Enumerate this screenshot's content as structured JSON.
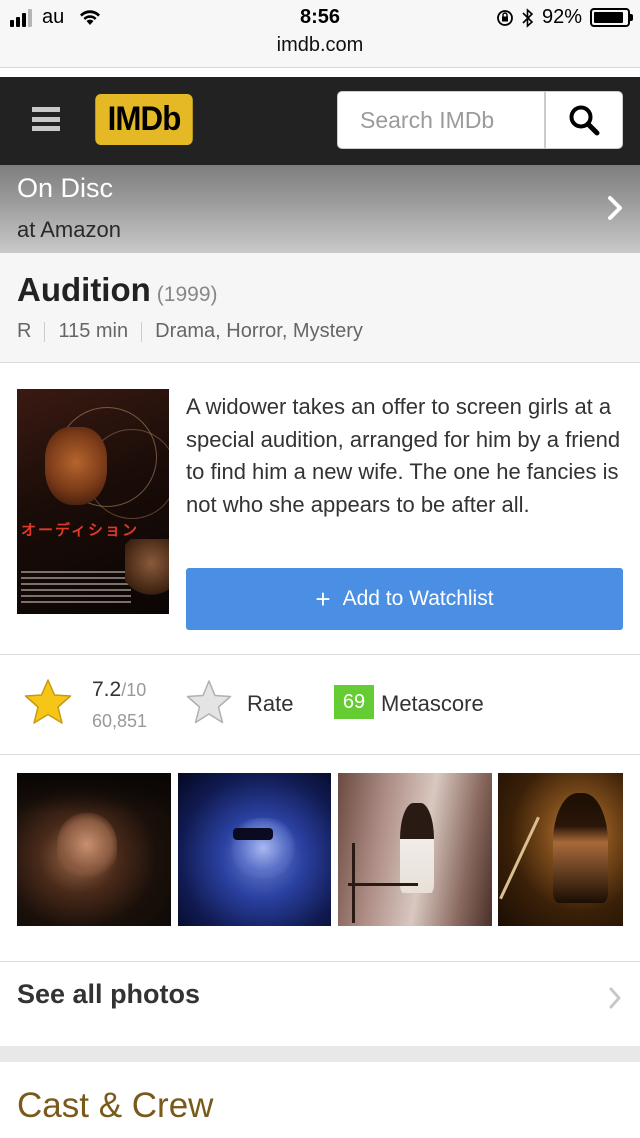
{
  "status_bar": {
    "carrier": "au",
    "time": "8:56",
    "battery": "92%",
    "battery_level": 0.92,
    "url": "imdb.com"
  },
  "navbar": {
    "logo": "IMDb",
    "search_placeholder": "Search IMDb",
    "brand_color": "#e5b825",
    "background": "#222222"
  },
  "banner": {
    "title": "On Disc",
    "subtitle": "at Amazon"
  },
  "movie": {
    "title": "Audition",
    "year": "(1999)",
    "rating": "R",
    "runtime": "115 min",
    "genres": "Drama, Horror, Mystery",
    "plot": "A widower takes an offer to screen girls at a special audition, arranged for him by a friend to find him a new wife. The one he fancies is not who she appears to be after all.",
    "poster_title_jp": "オーディション"
  },
  "watchlist": {
    "icon": "+",
    "label": "Add to Watchlist",
    "color": "#4a8fe3"
  },
  "ratings": {
    "score": "7.2",
    "out_of": "/10",
    "count": "60,851",
    "rate_label": "Rate",
    "metascore": "69",
    "metascore_label": "Metascore",
    "metascore_color": "#66cc33"
  },
  "photos": {
    "count_shown": 4,
    "see_all_label": "See all photos"
  },
  "cast": {
    "title": "Cast & Crew"
  },
  "icons": {
    "menu": "hamburger-icon",
    "search": "magnifier-icon",
    "banner_next": "chevron-right-icon",
    "rating_star": "star-filled-icon",
    "rate_star": "star-outline-icon"
  }
}
